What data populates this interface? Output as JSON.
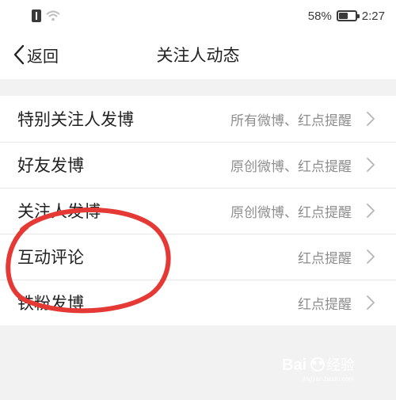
{
  "status_bar": {
    "battery_percent": "58%",
    "battery_level": 0.58,
    "time": "2:27"
  },
  "nav": {
    "back_label": "返回",
    "title": "关注人动态"
  },
  "items": [
    {
      "label": "特别关注人发博",
      "value": "所有微博、红点提醒"
    },
    {
      "label": "好友发博",
      "value": "原创微博、红点提醒"
    },
    {
      "label": "关注人发博",
      "value": "原创微博、红点提醒"
    },
    {
      "label": "互动评论",
      "value": "红点提醒"
    },
    {
      "label": "铁粉发博",
      "value": "红点提醒"
    }
  ],
  "watermark": {
    "text": "Baidu 经验",
    "url": "jingyan.baidu.com"
  },
  "colors": {
    "annotation": "#e53935",
    "text_primary": "#222222",
    "text_secondary": "#8e8e8e",
    "background": "#f2f2f2"
  }
}
